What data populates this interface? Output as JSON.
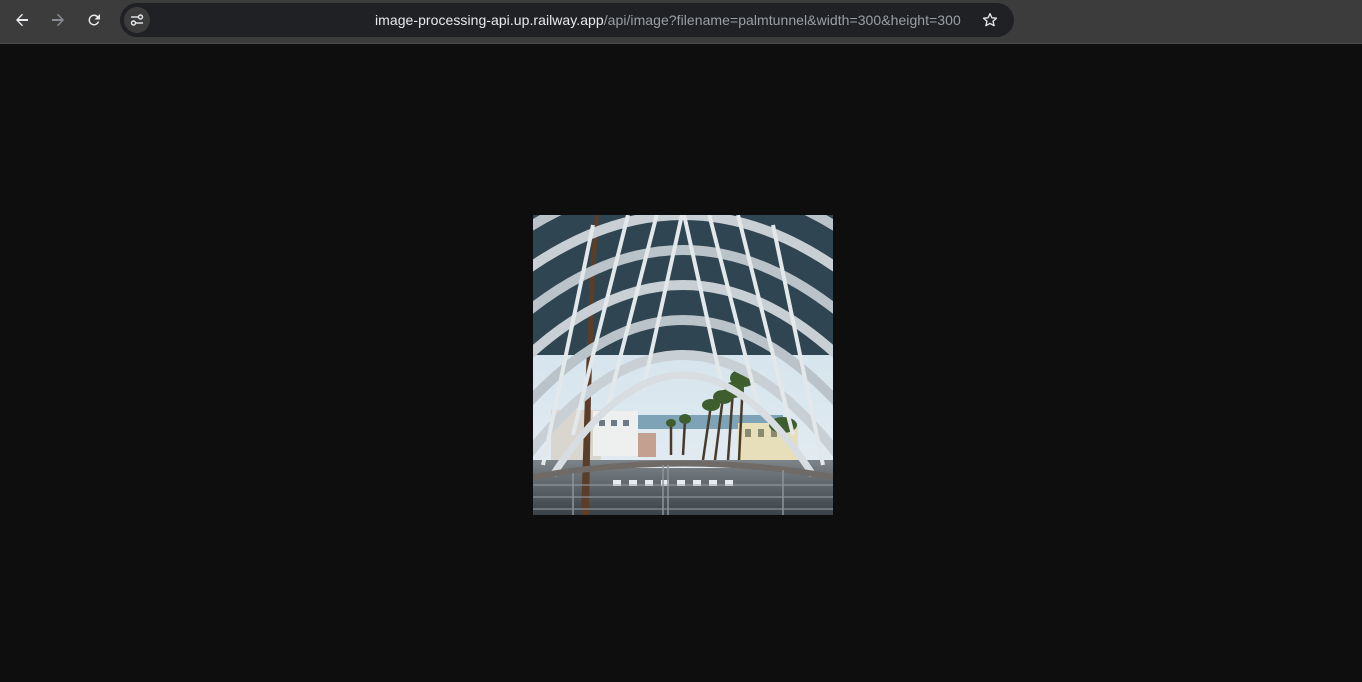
{
  "toolbar": {
    "back_icon": "arrow-left-icon",
    "forward_icon": "arrow-right-icon",
    "reload_icon": "reload-icon",
    "site_info_icon": "tune-icon",
    "bookmark_icon": "star-outline-icon"
  },
  "omnibox": {
    "url_host": "image-processing-api.up.railway.app",
    "url_path": "/api/image?filename=palmtunnel&width=300&height=300"
  },
  "content": {
    "image_alt": "palmtunnel"
  },
  "colors": {
    "toolbar_bg": "#3c3c3c",
    "omnibox_bg": "#202124",
    "page_bg": "#0e0e0e",
    "url_host": "#e8eaed",
    "url_path": "#9aa0a6"
  }
}
